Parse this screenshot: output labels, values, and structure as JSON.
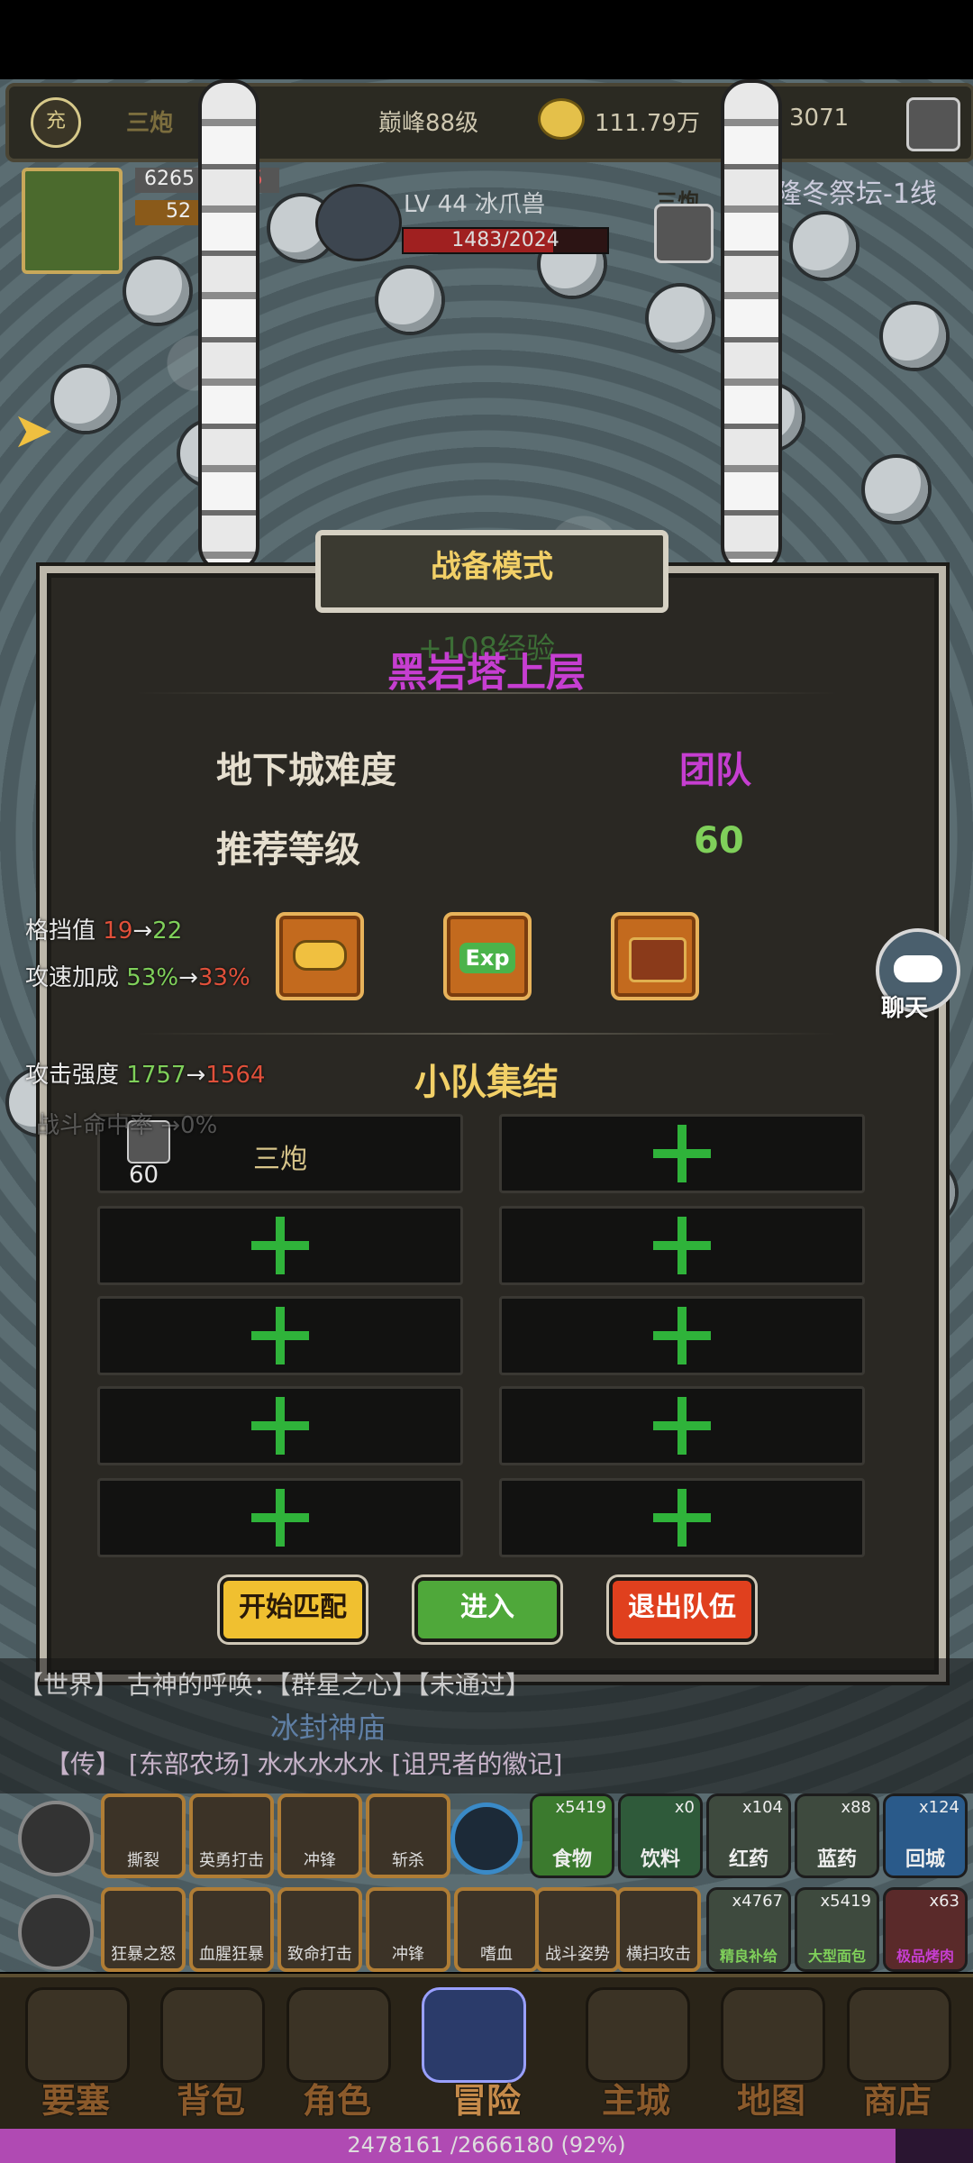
{
  "top_bar": {
    "charge_icon": "充",
    "player_name": "三炮",
    "peak_level": "巅峰88级",
    "gold": "111.79万",
    "gems": "3071"
  },
  "hud": {
    "hp_short": "6265",
    "hp_red": "5",
    "mp_short": "52",
    "target_level": "LV 44 冰爪兽",
    "target_hp": "1483/2024",
    "target_hp_fraction": 0.733,
    "location": "隆冬祭坛-1线",
    "badge_name": "三炮"
  },
  "modal": {
    "title": "战备模式",
    "exp_gain": "+108经验",
    "dungeon_name": "黑岩塔上层",
    "difficulty_label": "地下城难度",
    "difficulty_value": "团队",
    "rec_level_label": "推荐等级",
    "rec_level_value": "60",
    "squad_title": "小队集结",
    "slots": [
      {
        "name": "三炮",
        "level": "60",
        "empty": false
      },
      {
        "empty": true
      },
      {
        "empty": true
      },
      {
        "empty": true
      },
      {
        "empty": true
      },
      {
        "empty": true
      },
      {
        "empty": true
      },
      {
        "empty": true
      },
      {
        "empty": true
      },
      {
        "empty": true
      }
    ],
    "buttons": {
      "start_match": "开始匹配",
      "enter": "进入",
      "leave_team": "退出队伍"
    }
  },
  "stats_overlay": {
    "block_label": "格挡值",
    "block_from": "19",
    "block_arrow": "→",
    "block_to": "22",
    "atk_speed_label": "攻速加成",
    "atk_speed_from": "53%",
    "atk_speed_arrow": "→",
    "atk_speed_to": "33%",
    "atk_power_label": "攻击强度",
    "atk_power_from": "1757",
    "atk_power_arrow": "→",
    "atk_power_to": "1564",
    "hit_faded": "战斗命中率 →0%"
  },
  "chat_button": "聊天",
  "chat_lines": [
    {
      "text": "【世界】 古神的呼唤：【群星之心】【未通过】"
    },
    {
      "text": "冰封神庙"
    },
    {
      "text": "【传】 [东部农场] 水水水水水 [诅咒者的徽记]"
    }
  ],
  "skills_row1": [
    "撕裂",
    "英勇打击",
    "冲锋",
    "斩杀"
  ],
  "skills_row2": [
    "狂暴之怒",
    "血腥狂暴",
    "致命打击",
    "冲锋",
    "嗜血",
    "战斗姿势",
    "横扫攻击"
  ],
  "items_row1": [
    {
      "count": "x5419",
      "name": "食物",
      "color": "#3b7a2e"
    },
    {
      "count": "x0",
      "name": "饮料",
      "color": "#2f5a3a"
    },
    {
      "count": "x104",
      "name": "红药",
      "color": "#3e4a3e"
    },
    {
      "count": "x88",
      "name": "蓝药",
      "color": "#3e4a3e"
    },
    {
      "count": "x124",
      "name": "回城",
      "color": "#2a5a8a"
    }
  ],
  "items_row2": [
    {
      "count": "x4767",
      "name": "精良补给",
      "color": "#3e4a3e"
    },
    {
      "count": "x5419",
      "name": "大型面包",
      "color": "#3e4a3e"
    },
    {
      "count": "x63",
      "name": "极品烤肉",
      "color": "#5a2a2a"
    }
  ],
  "bottom_nav": [
    "要塞",
    "背包",
    "角色",
    "冒险",
    "主城",
    "地图",
    "商店"
  ],
  "xp": {
    "text": "2478161 /2666180 (92%)",
    "fraction": 0.92
  },
  "colors": {
    "purple": "#c63ed1",
    "green": "#7fd05a",
    "red": "#e0503a",
    "gold": "#f2d067"
  }
}
